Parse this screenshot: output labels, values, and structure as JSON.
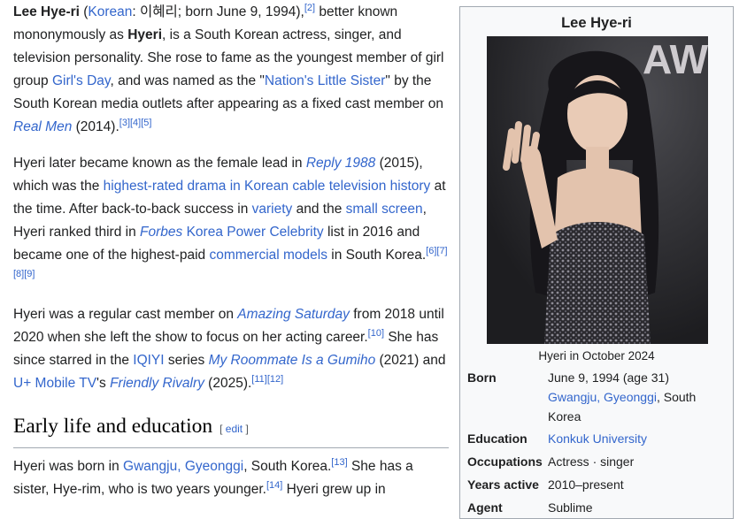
{
  "article": {
    "p1": {
      "name": "Lee Hye-ri",
      "lang_link": "Korean",
      "korean_suffix": ": 이혜리; born June 9, 1994),",
      "ref2": "[2]",
      "t1": " better known mononymously as ",
      "mononym": "Hyeri",
      "t2": ", is a South Korean actress, singer, and television personality. She rose to fame as the youngest member of girl group ",
      "group_link": "Girl's Day",
      "t3": ", and was named as the \"",
      "nation_link": "Nation's Little Sister",
      "t4": "\" by the South Korean media outlets after appearing as a fixed cast member on ",
      "show_link": "Real Men",
      "t5": " (2014).",
      "refs": "[3][4][5]"
    },
    "p2": {
      "t1": "Hyeri later became known as the female lead in ",
      "reply_link": "Reply 1988",
      "t2": " (2015), which was the ",
      "drama_link": "highest-rated drama in Korean cable television history",
      "t3": " at the time. After back-to-back success in ",
      "variety_link": "variety",
      "t4": " and the ",
      "screen_link": "small screen",
      "t5": ", Hyeri ranked third in ",
      "forbes_link": "Forbes",
      "forbes_rest_link": " Korea Power Celebrity",
      "t6": " list in 2016 and became one of the highest-paid ",
      "commercial_link": "commercial models",
      "t7": " in South Korea.",
      "refs": "[6][7][8][9]"
    },
    "p3": {
      "t1": "Hyeri was a regular cast member on ",
      "amazing_link": "Amazing Saturday",
      "t2": " from 2018 until 2020 when she left the show to focus on her acting career.",
      "ref10": "[10]",
      "t3": " She has since starred in the ",
      "iqiyi_link": "IQIYI",
      "t4": " series ",
      "gumiho_link": "My Roommate Is a Gumiho",
      "t5": " (2021) and ",
      "uplus_link": "U+ Mobile TV",
      "t6": "'s ",
      "rivalry_link": "Friendly Rivalry",
      "t7": " (2025).",
      "refs": "[11][12]"
    },
    "section": {
      "heading": "Early life and education",
      "bracket_open": "[ ",
      "edit_label": "edit",
      "bracket_close": " ]"
    },
    "p4": {
      "t1": "Hyeri was born in ",
      "born_link": "Gwangju, Gyeonggi",
      "t2": ", South Korea.",
      "ref13": "[13]",
      "t3": " She has a sister, Hye-rim, who is two years younger.",
      "ref14": "[14]",
      "t4": " Hyeri grew up in"
    }
  },
  "infobox": {
    "title": "Lee Hye-ri",
    "photo_backdrop_text": "AW",
    "caption": "Hyeri in October 2024",
    "born_label": "Born",
    "born_date": "June 9, 1994 (age 31)",
    "born_place_link": "Gwangju, Gyeonggi",
    "born_place_rest": ", South Korea",
    "education_label": "Education",
    "education_value": "Konkuk University",
    "occupations_label": "Occupations",
    "occupations_value": "Actress · singer",
    "years_label": "Years active",
    "years_value": "2010–present",
    "agent_label": "Agent",
    "agent_value": "Sublime"
  },
  "colors": {
    "link": "#3366cc",
    "text": "#202122",
    "infobox_bg": "#f8f9fa",
    "border": "#a2a9b1"
  }
}
